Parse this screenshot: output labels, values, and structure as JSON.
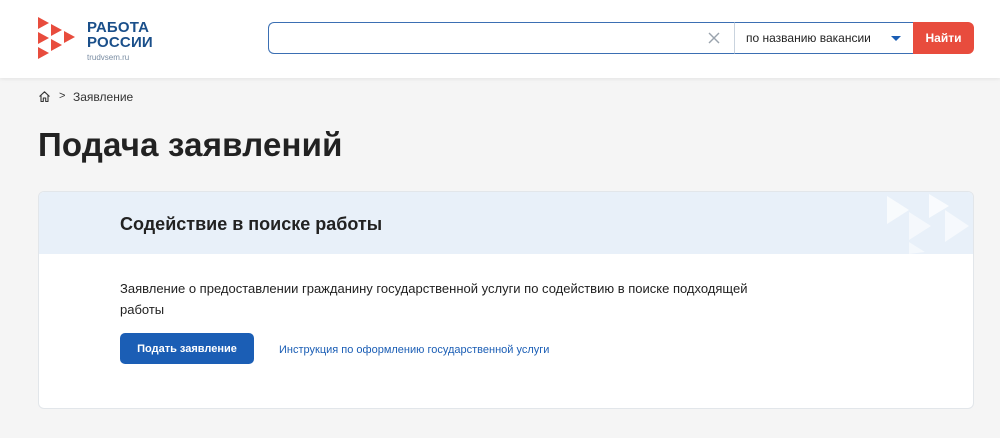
{
  "logo": {
    "line1": "РАБОТА",
    "line2": "РОССИИ",
    "site": "trudvsem.ru"
  },
  "search": {
    "value": "",
    "placeholder": "",
    "clear_icon": "close-icon",
    "select_value": "по названию вакансии",
    "button_label": "Найти"
  },
  "breadcrumb": {
    "home_icon": "home-icon",
    "separator": ">",
    "current": "Заявление"
  },
  "page": {
    "title": "Подача заявлений"
  },
  "card": {
    "title": "Содействие в поиске работы",
    "description": "Заявление о предоставлении гражданину государственной услуги по содействию в поиске подходящей работы",
    "apply_label": "Подать заявление",
    "instruction_link": "Инструкция по оформлению государственной услуги"
  },
  "colors": {
    "brand_blue": "#1b5eb5",
    "accent_red": "#e84c3d",
    "card_header_bg": "#e8f0f9",
    "page_bg": "#f5f5f5"
  }
}
